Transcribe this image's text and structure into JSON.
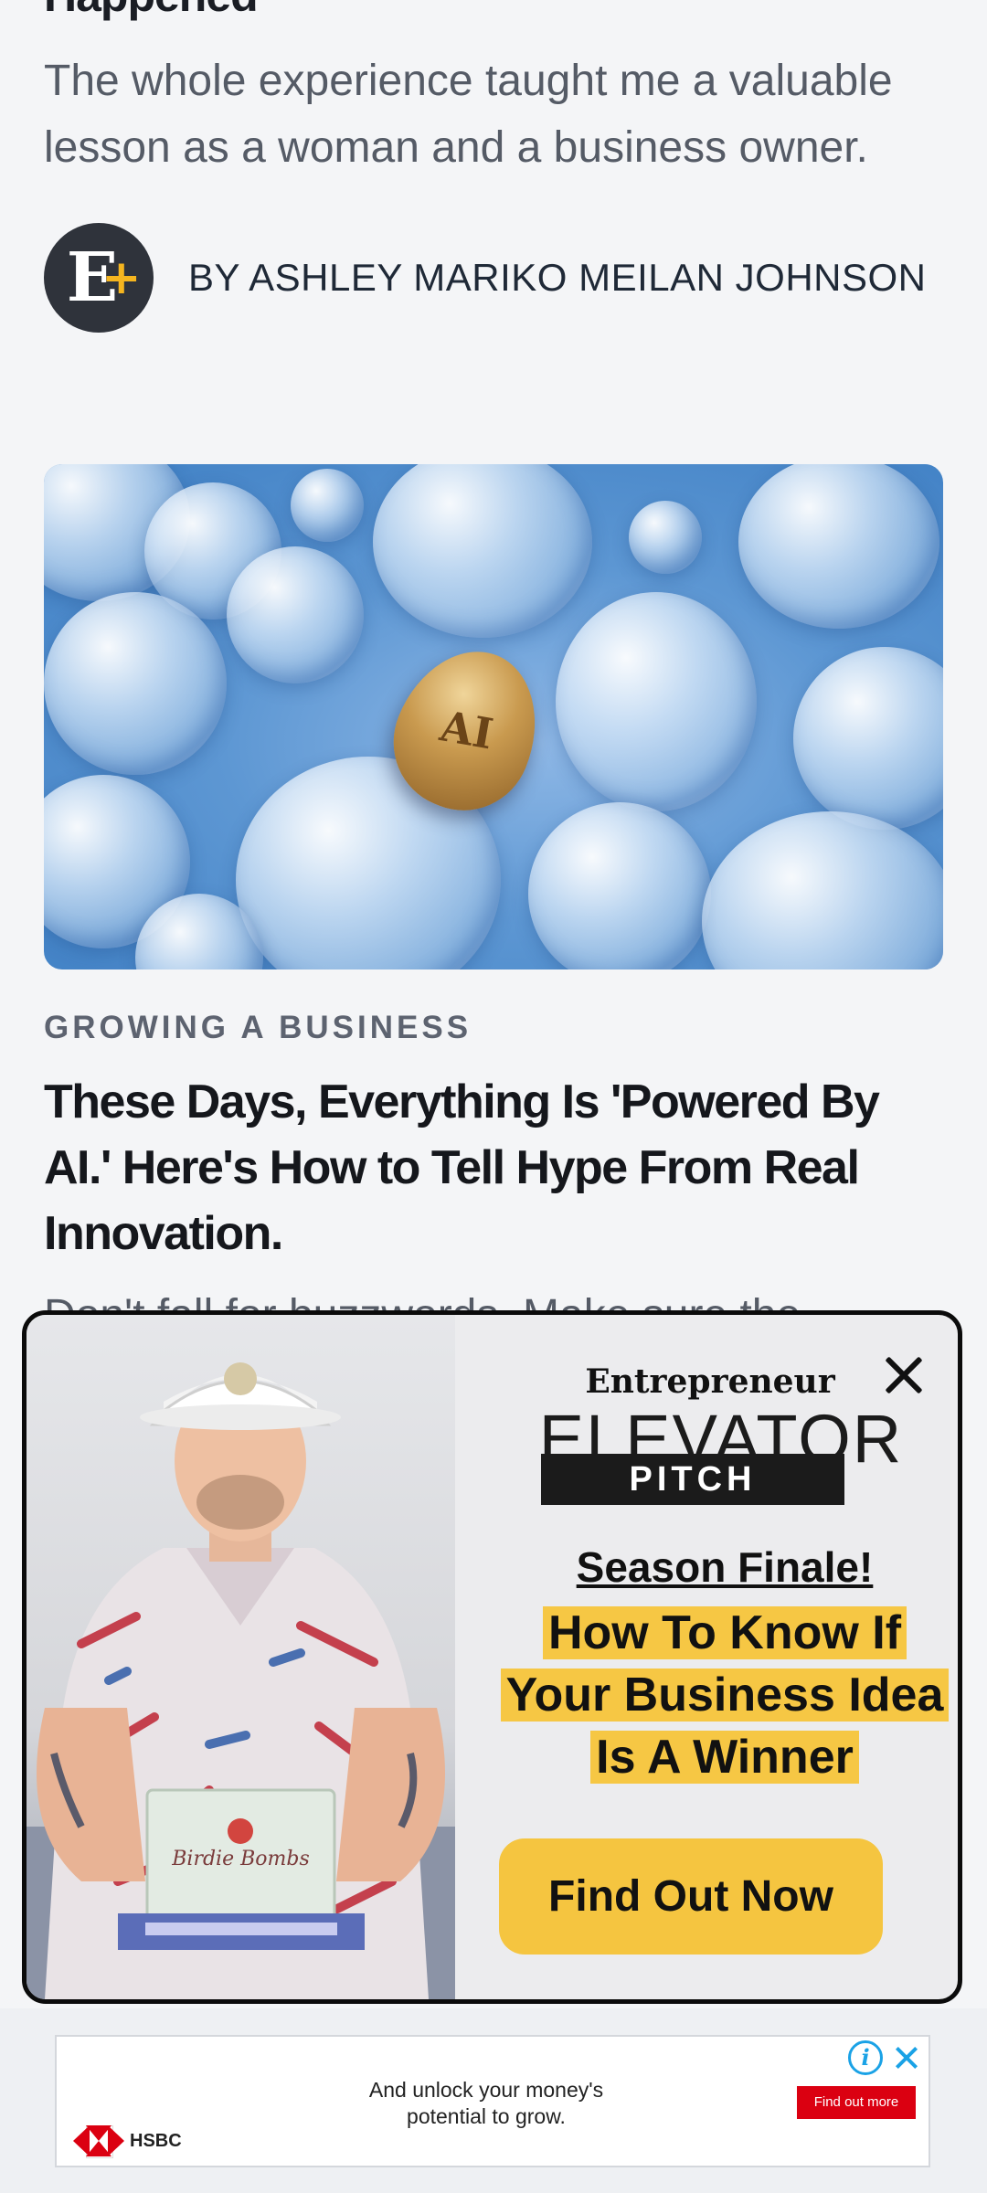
{
  "previous_article": {
    "title_fragment": "Happened",
    "dek": "The whole experience taught me a valuable lesson as a woman and a business owner.",
    "author_icon": "entrepreneur-plus-logo",
    "byline": "BY ASHLEY MARIKO MEILAN JOHNSON"
  },
  "feature_article": {
    "image_icon": "ai-bubbles-golden-egg",
    "category": "GROWING A BUSINESS",
    "headline": "These Days, Everything Is 'Powered By AI.' Here's How to Tell Hype From Real Innovation.",
    "dek_partial": "Don't fall for buzzwords. Make sure the"
  },
  "popup_ad": {
    "brand": "Entrepreneur",
    "show_name_top": "ELEVATOR",
    "show_name_bottom": "PITCH",
    "finale": "Season Finale!",
    "tagline": "How To Know If Your Business Idea Is A Winner",
    "cta": "Find Out Now",
    "product_label": "Birdie Bombs",
    "close_icon": "close-icon",
    "highlight_color": "#f6c744",
    "button_color": "#f5c540"
  },
  "banner_ad": {
    "text": "And unlock your money's potential to grow.",
    "cta": "Find out more",
    "advertiser": "HSBC",
    "adchoices_glyph": "i",
    "brand_color": "#db0011"
  }
}
